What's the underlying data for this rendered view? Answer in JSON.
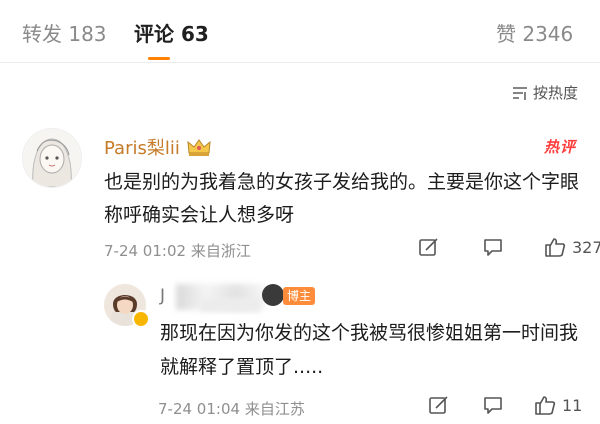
{
  "tabs": {
    "reposts": "转发 183",
    "comments": "评论 63",
    "likes": "赞 2346"
  },
  "sort": {
    "label": "按热度"
  },
  "comment": {
    "user_name": "Paris梨lii",
    "hot_badge": "热评",
    "text": "也是别的为我着急的女孩子发给我的。主要是你这个字眼称呼确实会让人想多呀",
    "timestamp": "7-24 01:02",
    "location": "来自浙江",
    "like_count": "327"
  },
  "reply": {
    "user_name_partial": "J",
    "badge": "博主",
    "text": "那现在因为你发的这个我被骂很惨姐姐第一时间我就解释了置顶了.....",
    "timestamp": "7-24 01:04",
    "location": "来自江苏",
    "like_count": "11"
  },
  "colors": {
    "accent": "#ff8200",
    "username": "#c67b2a",
    "hot": "#ff3e3e",
    "blogger_badge": "#ff8c3a"
  }
}
